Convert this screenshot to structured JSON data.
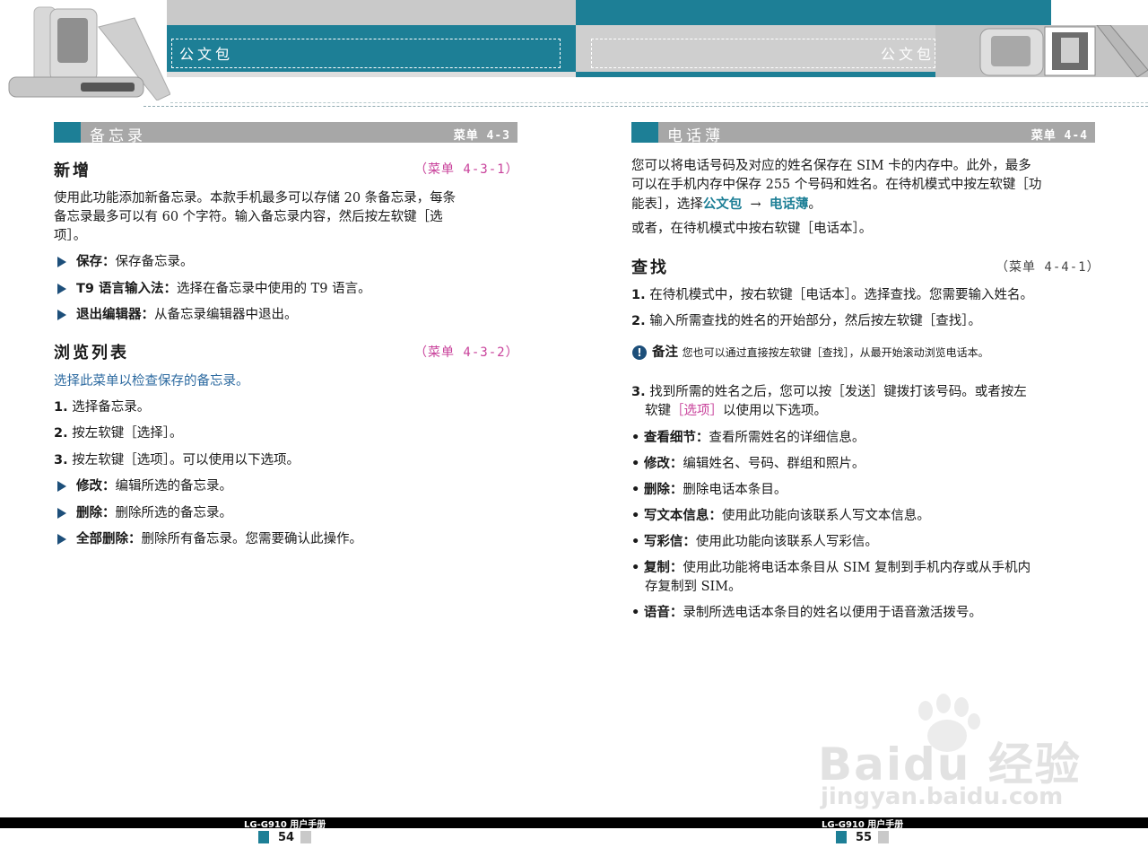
{
  "header": {
    "left_title": "公文包",
    "right_title": "公文包"
  },
  "left": {
    "section": {
      "title": "备忘录",
      "menu": "菜单 4-3"
    },
    "add": {
      "heading": "新增",
      "ref": "（菜单 4-3-1）",
      "desc1": "使用此功能添加新备忘录。本款手机最多可以存储 20 条备忘录，每条",
      "desc2": "备忘录最多可以有 60 个字符。输入备忘录内容，然后按左软键［选",
      "desc3": "项］。",
      "items": [
        {
          "label": "保存：",
          "text": "保存备忘录。"
        },
        {
          "label": "T9 语言输入法：",
          "text": "选择在备忘录中使用的 T9 语言。"
        },
        {
          "label": "退出编辑器：",
          "text": "从备忘录编辑器中退出。"
        }
      ]
    },
    "browse": {
      "heading": "浏览列表",
      "ref": "（菜单 4-3-2）",
      "intro": "选择此菜单以检查保存的备忘录。",
      "steps": [
        {
          "n": "1.",
          "text": "选择备忘录。"
        },
        {
          "n": "2.",
          "text": "按左软键［选择］。"
        },
        {
          "n": "3.",
          "text": "按左软键［选项］。可以使用以下选项。"
        }
      ],
      "items": [
        {
          "label": "修改：",
          "text": "编辑所选的备忘录。"
        },
        {
          "label": "删除：",
          "text": "删除所选的备忘录。"
        },
        {
          "label": "全部删除：",
          "text": "删除所有备忘录。您需要确认此操作。"
        }
      ]
    }
  },
  "right": {
    "section": {
      "title": "电话薄",
      "menu": "菜单 4-4"
    },
    "intro1": "您可以将电话号码及对应的姓名保存在 SIM 卡的内存中。此外，最多",
    "intro2": "可以在手机内存中保存 255 个号码和姓名。在待机模式中按左软键［功",
    "intro3a": "能表］，选择",
    "intro3_link1": "公文包",
    "intro3_arrow": "→",
    "intro3_link2": "电话薄",
    "intro3b": "。",
    "intro4": "或者，在待机模式中按右软键［电话本］。",
    "find": {
      "heading": "查找",
      "ref": "（菜单 4-4-1）",
      "steps": [
        {
          "n": "1.",
          "text": "在待机模式中，按右软键［电话本］。选择查找。您需要输入姓名。"
        },
        {
          "n": "2.",
          "text": "输入所需查找的姓名的开始部分，然后按左软键［查找］。"
        }
      ],
      "note_label": "备注",
      "note_text": "您也可以通过直接按左软键［查找］，从最开始滚动浏览电话本。",
      "step3_n": "3.",
      "step3_line1": "找到所需的姓名之后，您可以按［发送］键拨打该号码。或者按左",
      "step3_line2a": "软键",
      "step3_line2_pink": "［选项］",
      "step3_line2b": "以使用以下选项。",
      "bullets": [
        {
          "label": "查看细节：",
          "text": "查看所需姓名的详细信息。"
        },
        {
          "label": "修改：",
          "text": "编辑姓名、号码、群组和照片。"
        },
        {
          "label": "删除：",
          "text": "删除电话本条目。"
        },
        {
          "label": "写文本信息：",
          "text": "使用此功能向该联系人写文本信息。"
        },
        {
          "label": "写彩信：",
          "text": "使用此功能向该联系人写彩信。"
        },
        {
          "label": "复制：",
          "text": "使用此功能将电话本条目从 SIM 复制到手机内存或从手机内"
        },
        {
          "label": "语音：",
          "text": "录制所选电话本条目的姓名以便用于语音激活拨号。"
        }
      ],
      "copy_line2": "存复制到 SIM。",
      "bullet_mark": "•"
    }
  },
  "footer": {
    "left_model": "LG-G910 用户手册",
    "left_page": "54",
    "right_model": "LG-G910 用户手册",
    "right_page": "55"
  },
  "watermark": {
    "brand": "Baidu 经验",
    "url": "jingyan.baidu.com"
  },
  "colors": {
    "teal": "#1d7f96",
    "link": "#c8409a",
    "bar": "#a7a7a7"
  }
}
